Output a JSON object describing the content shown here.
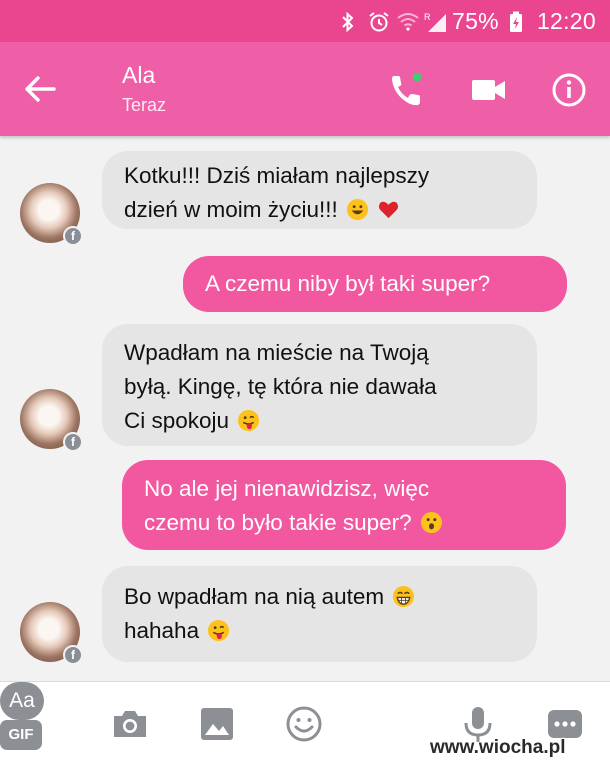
{
  "status_bar": {
    "battery_percent": "75%",
    "time": "12:20",
    "icons": [
      "bluetooth-icon",
      "alarm-icon",
      "wifi-icon",
      "roaming-signal-icon",
      "battery-charging-icon"
    ],
    "background": "#e9468f"
  },
  "header": {
    "contact_name": "Ala",
    "contact_status": "Teraz",
    "background": "#ef5fa7",
    "actions": [
      "back-arrow-icon",
      "phone-call-icon",
      "video-camera-icon",
      "info-icon"
    ],
    "online_dot_color": "#3bd16f"
  },
  "messages": [
    {
      "from": "them",
      "lines": [
        "Kotku!!! Dziś miałam najlepszy",
        "dzień w moim życiu!!!"
      ],
      "emojis": [
        "grinning-emoji",
        "red-heart-emoji"
      ]
    },
    {
      "from": "me",
      "lines": [
        "A czemu niby był taki super?"
      ],
      "emojis": []
    },
    {
      "from": "them",
      "lines": [
        "Wpadłam na mieście na Twoją",
        "byłą. Kingę, tę która nie dawała",
        "Ci spokoju"
      ],
      "emojis": [
        "tongue-out-emoji"
      ]
    },
    {
      "from": "me",
      "lines": [
        "No ale jej nienawidzisz, więc",
        "czemu to było takie super?"
      ],
      "emojis": [
        "astonished-emoji"
      ]
    },
    {
      "from": "them",
      "lines": [
        "Bo wpadłam na nią autem",
        "hahaha"
      ],
      "emojis": [
        "beaming-grin-emoji",
        "tongue-out-emoji"
      ]
    }
  ],
  "composer": {
    "text_button_label": "Aa",
    "gif_label": "GIF",
    "icons": [
      "camera-icon",
      "image-icon",
      "emoji-face-icon",
      "microphone-icon",
      "more-icon"
    ]
  },
  "colors": {
    "incoming_bubble": "#e5e5e5",
    "outgoing_bubble": "#f1589f",
    "icon_grey": "#8c8f93"
  },
  "watermark": "www.wiocha.pl"
}
